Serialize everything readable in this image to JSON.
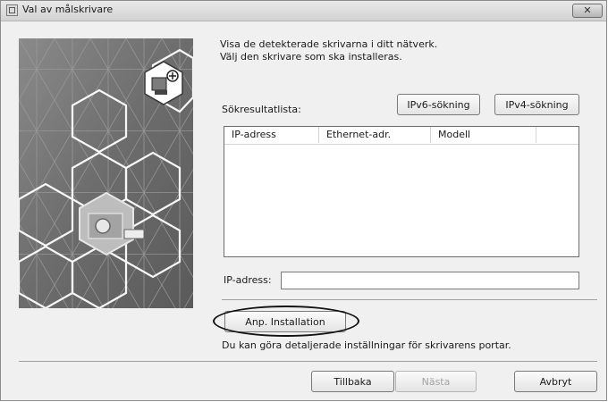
{
  "window": {
    "title": "Val av målskrivare",
    "close_label": "✕"
  },
  "intro": {
    "line1": "Visa de detekterade skrivarna i ditt nätverk.",
    "line2": "Välj den skrivare som ska installeras."
  },
  "search": {
    "results_label": "Sökresultatlista:",
    "ipv6_button": "IPv6-sökning",
    "ipv4_button": "IPv4-sökning"
  },
  "table": {
    "columns": [
      "IP-adress",
      "Ethernet-adr.",
      "Modell",
      ""
    ],
    "rows": []
  },
  "ip_field": {
    "label": "IP-adress:",
    "value": ""
  },
  "custom_install": {
    "button": "Anp. Installation",
    "hint": "Du kan göra detaljerade inställningar för skrivarens portar."
  },
  "footer": {
    "back": "Tillbaka",
    "next": "Nästa",
    "cancel": "Avbryt"
  },
  "colors": {
    "dialog_bg": "#f0f0f0",
    "highlight_ellipse": "#111111"
  },
  "icons": [
    "printer-network-icon",
    "printer-device-icon",
    "window-icon",
    "close-icon"
  ]
}
